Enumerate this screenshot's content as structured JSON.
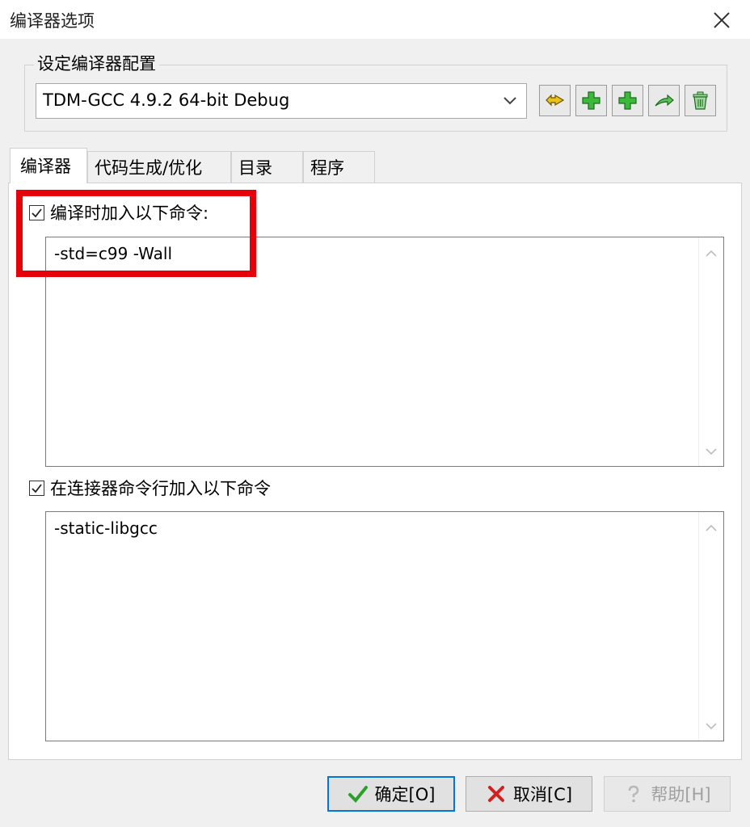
{
  "window": {
    "title": "编译器选项"
  },
  "group": {
    "label": "设定编译器配置",
    "selected_config": "TDM-GCC 4.9.2 64-bit Debug",
    "toolbar_icons": [
      "rename-icon",
      "add-icon",
      "add-copy-icon",
      "export-icon",
      "delete-icon"
    ]
  },
  "tabs": [
    {
      "label": "编译器",
      "active": true
    },
    {
      "label": "代码生成/优化",
      "active": false
    },
    {
      "label": "目录",
      "active": false
    },
    {
      "label": "程序",
      "active": false
    }
  ],
  "compiler": {
    "compile_checkbox_label": "编译时加入以下命令:",
    "compile_checked": true,
    "compile_commands": "-std=c99 -Wall",
    "linker_checkbox_label": "在连接器命令行加入以下命令",
    "linker_checked": true,
    "linker_commands": "-static-libgcc"
  },
  "buttons": {
    "ok": "确定[O]",
    "cancel": "取消[C]",
    "help": "帮助[H]"
  },
  "colors": {
    "highlight": "#e6000a",
    "accent": "#0078d7",
    "icon_green": "#3cb83c"
  }
}
